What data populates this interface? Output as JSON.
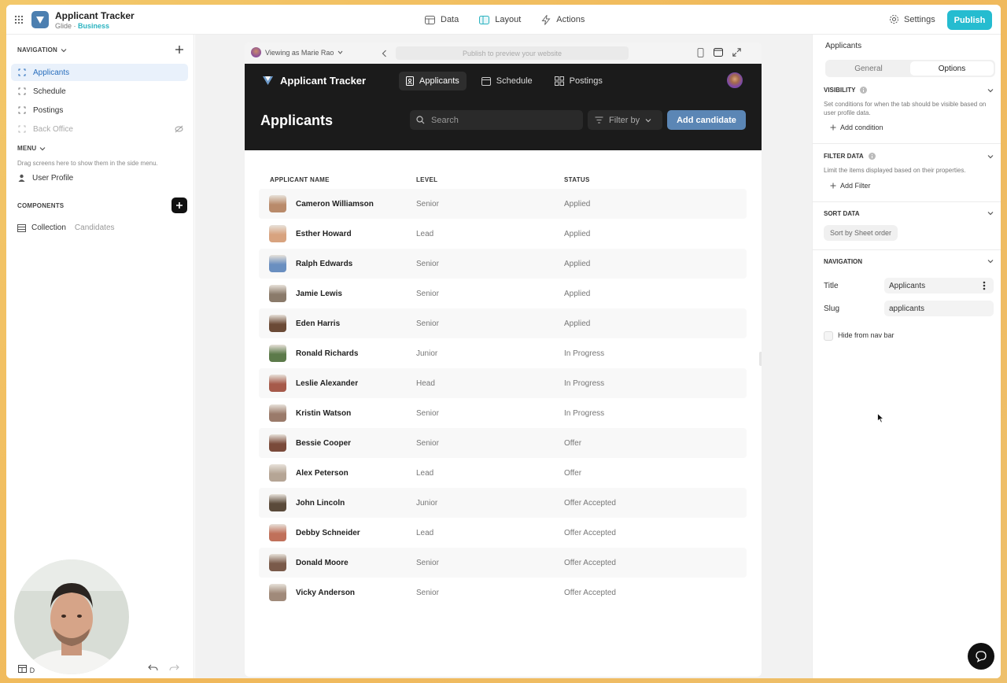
{
  "topbar": {
    "app_title": "Applicant Tracker",
    "app_sub_prefix": "Glide · ",
    "app_sub_plan": "Business",
    "tabs": [
      {
        "label": "Data",
        "icon": "database-icon"
      },
      {
        "label": "Layout",
        "icon": "layout-icon"
      },
      {
        "label": "Actions",
        "icon": "lightning-icon"
      }
    ],
    "settings_label": "Settings",
    "publish_label": "Publish"
  },
  "left": {
    "navigation_head": "NAVIGATION",
    "nav_items": [
      {
        "label": "Applicants"
      },
      {
        "label": "Schedule"
      },
      {
        "label": "Postings"
      },
      {
        "label": "Back Office"
      }
    ],
    "menu_head": "MENU",
    "menu_hint": "Drag screens here to show them in the side menu.",
    "user_profile": "User Profile",
    "components_head": "COMPONENTS",
    "collection_label": "Collection",
    "collection_sub": "Candidates",
    "bottom_label": "D"
  },
  "preview": {
    "viewing_as": "Viewing as Marie Rao",
    "url_placeholder": "Publish to preview your website",
    "app_name": "Applicant Tracker",
    "tabs": [
      {
        "label": "Applicants",
        "icon": "id-badge-icon"
      },
      {
        "label": "Schedule",
        "icon": "calendar-icon"
      },
      {
        "label": "Postings",
        "icon": "grid-icon"
      }
    ],
    "page_title": "Applicants",
    "search_placeholder": "Search",
    "filter_label": "Filter by",
    "add_button": "Add candidate",
    "columns": [
      "APPLICANT NAME",
      "LEVEL",
      "STATUS"
    ],
    "rows": [
      {
        "name": "Cameron Williamson",
        "level": "Senior",
        "status": "Applied",
        "color": "#b98a6a"
      },
      {
        "name": "Esther Howard",
        "level": "Lead",
        "status": "Applied",
        "color": "#d8a37f"
      },
      {
        "name": "Ralph Edwards",
        "level": "Senior",
        "status": "Applied",
        "color": "#6a8fc0"
      },
      {
        "name": "Jamie Lewis",
        "level": "Senior",
        "status": "Applied",
        "color": "#8a7a6a"
      },
      {
        "name": "Eden Harris",
        "level": "Senior",
        "status": "Applied",
        "color": "#6b4a36"
      },
      {
        "name": "Ronald Richards",
        "level": "Junior",
        "status": "In Progress",
        "color": "#5c7a4a"
      },
      {
        "name": "Leslie Alexander",
        "level": "Head",
        "status": "In Progress",
        "color": "#a65a4a"
      },
      {
        "name": "Kristin Watson",
        "level": "Senior",
        "status": "In Progress",
        "color": "#9a7a6a"
      },
      {
        "name": "Bessie Cooper",
        "level": "Senior",
        "status": "Offer",
        "color": "#7a4a3a"
      },
      {
        "name": "Alex Peterson",
        "level": "Lead",
        "status": "Offer",
        "color": "#b5a595"
      },
      {
        "name": "John Lincoln",
        "level": "Junior",
        "status": "Offer Accepted",
        "color": "#5a4a3a"
      },
      {
        "name": "Debby Schneider",
        "level": "Lead",
        "status": "Offer Accepted",
        "color": "#c0705a"
      },
      {
        "name": "Donald Moore",
        "level": "Senior",
        "status": "Offer Accepted",
        "color": "#7a5a4a"
      },
      {
        "name": "Vicky Anderson",
        "level": "Senior",
        "status": "Offer Accepted",
        "color": "#a08a7a"
      }
    ]
  },
  "right": {
    "title": "Applicants",
    "seg_general": "General",
    "seg_options": "Options",
    "visibility_head": "VISIBILITY",
    "visibility_desc": "Set conditions for when the tab should be visible based on user profile data.",
    "add_condition": "Add condition",
    "filter_head": "FILTER DATA",
    "filter_desc": "Limit the items displayed based on their properties.",
    "add_filter": "Add Filter",
    "sort_head": "SORT DATA",
    "sort_chip": "Sort by Sheet order",
    "navigation_head": "NAVIGATION",
    "title_label": "Title",
    "title_value": "Applicants",
    "slug_label": "Slug",
    "slug_value": "applicants",
    "hide_label": "Hide from nav bar"
  },
  "colors": {
    "accent": "#25bcd0",
    "active_nav_bg": "#e9f1fb",
    "dark_header": "#1b1b1b",
    "add_button": "#5b86b5"
  }
}
